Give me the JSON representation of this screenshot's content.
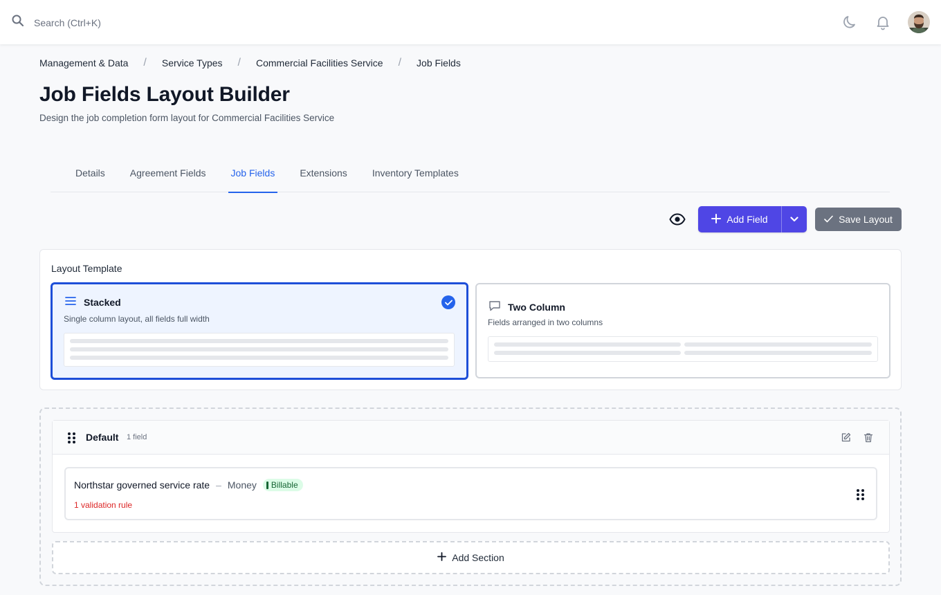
{
  "header": {
    "search_placeholder": "Search (Ctrl+K)",
    "icons": [
      "search-icon",
      "moon-icon",
      "bell-icon",
      "avatar"
    ]
  },
  "breadcrumb": {
    "items": [
      "Management & Data",
      "Service Types",
      "Commercial Facilities Service",
      "Job Fields"
    ],
    "separator": "/"
  },
  "page": {
    "title": "Job Fields Layout Builder",
    "subtitle": "Design the job completion form layout for Commercial Facilities Service"
  },
  "tabs": [
    {
      "label": "Details",
      "active": false
    },
    {
      "label": "Agreement Fields",
      "active": false
    },
    {
      "label": "Job Fields",
      "active": true
    },
    {
      "label": "Extensions",
      "active": false
    },
    {
      "label": "Inventory Templates",
      "active": false
    }
  ],
  "toolbar": {
    "add_field_label": "Add Field",
    "save_layout_label": "Save Layout"
  },
  "layout_template": {
    "label": "Layout Template",
    "options": [
      {
        "name": "Stacked",
        "description": "Single column layout, all fields full width",
        "selected": true,
        "icon": "list-icon"
      },
      {
        "name": "Two Column",
        "description": "Fields arranged in two columns",
        "selected": false,
        "icon": "columns-icon"
      }
    ]
  },
  "sections": [
    {
      "title": "Default",
      "count": "1 field",
      "fields": [
        {
          "name": "Northstar governed service rate",
          "separator": "–",
          "type": "Money",
          "badge": "Billable",
          "validation": "1 validation rule"
        }
      ]
    }
  ],
  "add_section_label": "Add Section",
  "colors": {
    "primary": "#4f46e5",
    "accent_blue": "#2563eb",
    "save_gray": "#6b7280",
    "badge_bg": "#dcfce7",
    "badge_text": "#166534",
    "validation_red": "#dc2626"
  }
}
